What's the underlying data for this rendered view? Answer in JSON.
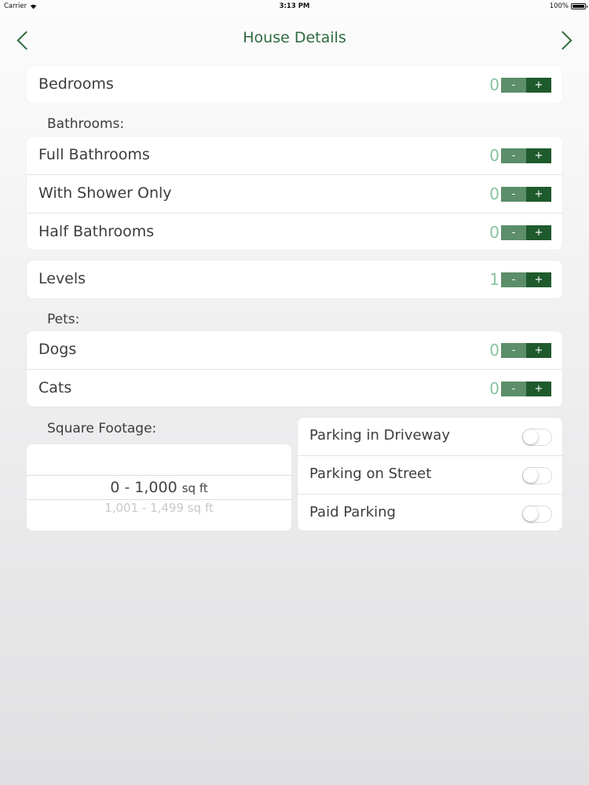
{
  "status_bar": {
    "carrier": "Carrier",
    "time": "3:13 PM",
    "battery": "100%",
    "battery_level": 1.0
  },
  "nav": {
    "title": "House Details",
    "back_icon": "chevron-left-icon",
    "forward_icon": "chevron-right-icon"
  },
  "stepper_buttons": {
    "minus": "-",
    "plus": "+"
  },
  "bedrooms": {
    "label": "Bedrooms",
    "value": "0"
  },
  "bathrooms": {
    "header": "Bathrooms:",
    "items": [
      {
        "label": "Full Bathrooms",
        "value": "0"
      },
      {
        "label": "With Shower Only",
        "value": "0"
      },
      {
        "label": "Half Bathrooms",
        "value": "0"
      }
    ]
  },
  "levels": {
    "label": "Levels",
    "value": "1"
  },
  "pets": {
    "header": "Pets:",
    "items": [
      {
        "label": "Dogs",
        "value": "0"
      },
      {
        "label": "Cats",
        "value": "0"
      }
    ]
  },
  "square_footage": {
    "header": "Square Footage:",
    "selected": {
      "range": "0 - 1,000",
      "unit": "sq ft"
    },
    "next": {
      "range": "1,001 - 1,499",
      "unit": "sq ft"
    }
  },
  "parking": {
    "items": [
      {
        "label": "Parking in Driveway",
        "on": false
      },
      {
        "label": "Parking on Street",
        "on": false
      },
      {
        "label": "Paid Parking",
        "on": false
      }
    ]
  },
  "colors": {
    "accent": "#2f6a3f",
    "stepper_minus": "#5c8e6a",
    "stepper_plus": "#1f5a2c",
    "value": "#88c4a0"
  }
}
